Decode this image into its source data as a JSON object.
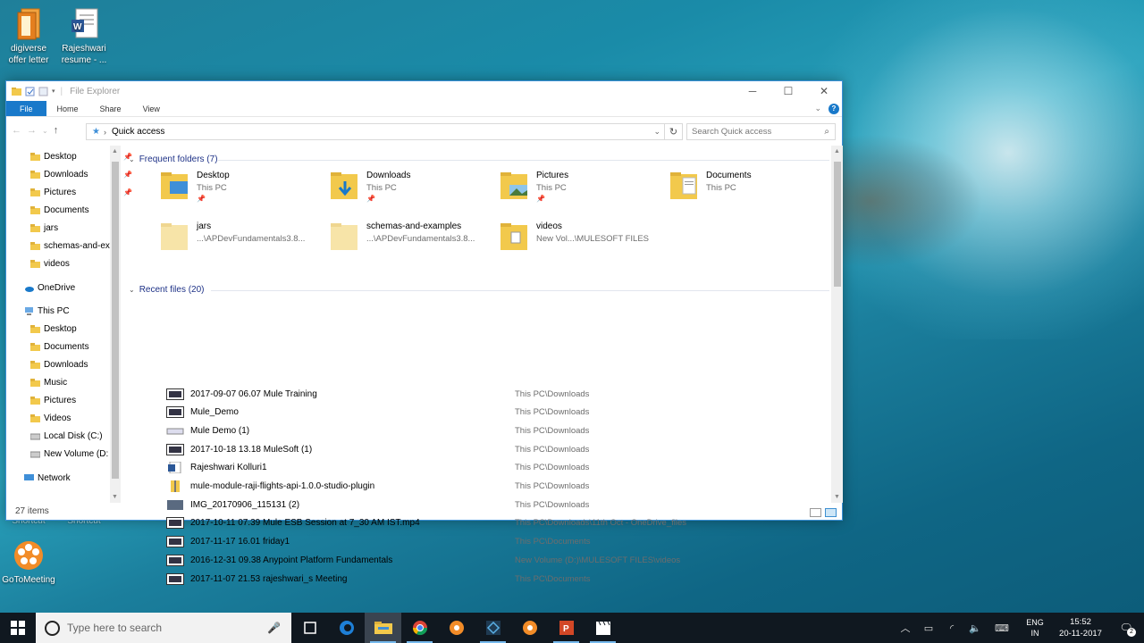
{
  "desktop": {
    "icons": [
      {
        "label1": "digiverse",
        "label2": "offer letter"
      },
      {
        "label1": "Rajeshwari",
        "label2": "resume - ..."
      },
      {
        "label1": "GoToMeeting",
        "label2": ""
      }
    ],
    "hidden_labels": [
      "Shortcut",
      "Shortcut"
    ]
  },
  "window": {
    "title": "File Explorer",
    "ribbon_tabs": [
      "File",
      "Home",
      "Share",
      "View"
    ],
    "address": "Quick access",
    "search_placeholder": "Search Quick access",
    "status": "27 items"
  },
  "navpane": {
    "quick": [
      {
        "label": "Desktop",
        "pinned": true
      },
      {
        "label": "Downloads",
        "pinned": true
      },
      {
        "label": "Pictures",
        "pinned": true
      },
      {
        "label": "Documents",
        "pinned": false
      },
      {
        "label": "jars",
        "pinned": false
      },
      {
        "label": "schemas-and-ex",
        "pinned": false
      },
      {
        "label": "videos",
        "pinned": false
      }
    ],
    "onedrive": "OneDrive",
    "thispc": "This PC",
    "pc_items": [
      "Desktop",
      "Documents",
      "Downloads",
      "Music",
      "Pictures",
      "Videos",
      "Local Disk (C:)",
      "New Volume (D:"
    ],
    "network": "Network"
  },
  "frequent": {
    "header": "Frequent folders (7)",
    "folders": [
      {
        "name": "Desktop",
        "location": "This PC",
        "pinned": true
      },
      {
        "name": "Downloads",
        "location": "This PC",
        "pinned": true
      },
      {
        "name": "Pictures",
        "location": "This PC",
        "pinned": true
      },
      {
        "name": "Documents",
        "location": "This PC",
        "pinned": false
      },
      {
        "name": "jars",
        "location": "...\\APDevFundamentals3.8...",
        "pinned": false
      },
      {
        "name": "schemas-and-examples",
        "location": "...\\APDevFundamentals3.8...",
        "pinned": false
      },
      {
        "name": "videos",
        "location": "New Vol...\\MULESOFT FILES",
        "pinned": false
      }
    ]
  },
  "recent": {
    "header": "Recent files (20)",
    "files": [
      {
        "name": "2017-09-07 06.07 Mule Training",
        "path": "This PC\\Downloads"
      },
      {
        "name": "Mule_Demo",
        "path": "This PC\\Downloads"
      },
      {
        "name": "Mule Demo (1)",
        "path": "This PC\\Downloads"
      },
      {
        "name": "2017-10-18 13.18 MuleSoft (1)",
        "path": "This PC\\Downloads"
      },
      {
        "name": "Rajeshwari Kolluri1",
        "path": "This PC\\Downloads"
      },
      {
        "name": "mule-module-raji-flights-api-1.0.0-studio-plugin",
        "path": "This PC\\Downloads"
      },
      {
        "name": "IMG_20170906_115131 (2)",
        "path": "This PC\\Downloads"
      },
      {
        "name": "2017-10-11 07.39 Mule ESB Session at 7_30 AM IST.mp4",
        "path": "This PC\\Downloads\\11th Oct - OneDrive_files"
      },
      {
        "name": "2017-11-17 16.01 friday1",
        "path": "This PC\\Documents"
      },
      {
        "name": "2016-12-31 09.38 Anypoint Platform Fundamentals",
        "path": "New Volume (D:)\\MULESOFT FILES\\videos"
      },
      {
        "name": "2017-11-07 21.53 rajeshwari_s Meeting",
        "path": "This PC\\Documents"
      }
    ]
  },
  "taskbar": {
    "search_placeholder": "Type here to search",
    "lang1": "ENG",
    "lang2": "IN",
    "time": "15:52",
    "date": "20-11-2017",
    "notifications": "2"
  },
  "colors": {
    "accent": "#1979ca",
    "folder": "#f2c94c",
    "group_header": "#1e3287"
  }
}
